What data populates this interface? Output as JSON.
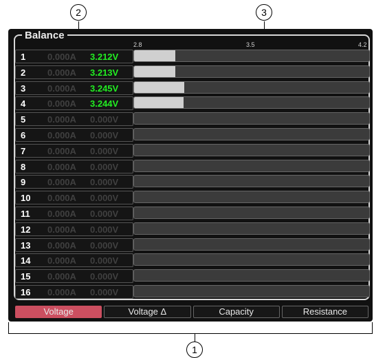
{
  "callouts": {
    "tabs": "1",
    "values": "2",
    "bars": "3"
  },
  "panel": {
    "title": "Balance"
  },
  "scale": {
    "min": "2.8",
    "mid": "3.5",
    "max": "4.2"
  },
  "cells": [
    {
      "num": "1",
      "amp": "0.000A",
      "volt": "3.212V",
      "active": true,
      "fill": 0.174
    },
    {
      "num": "2",
      "amp": "0.000A",
      "volt": "3.213V",
      "active": true,
      "fill": 0.175
    },
    {
      "num": "3",
      "amp": "0.000A",
      "volt": "3.245V",
      "active": true,
      "fill": 0.212
    },
    {
      "num": "4",
      "amp": "0.000A",
      "volt": "3.244V",
      "active": true,
      "fill": 0.211
    },
    {
      "num": "5",
      "amp": "0.000A",
      "volt": "0.000V",
      "active": false,
      "fill": 0
    },
    {
      "num": "6",
      "amp": "0.000A",
      "volt": "0.000V",
      "active": false,
      "fill": 0
    },
    {
      "num": "7",
      "amp": "0.000A",
      "volt": "0.000V",
      "active": false,
      "fill": 0
    },
    {
      "num": "8",
      "amp": "0.000A",
      "volt": "0.000V",
      "active": false,
      "fill": 0
    },
    {
      "num": "9",
      "amp": "0.000A",
      "volt": "0.000V",
      "active": false,
      "fill": 0
    },
    {
      "num": "10",
      "amp": "0.000A",
      "volt": "0.000V",
      "active": false,
      "fill": 0
    },
    {
      "num": "11",
      "amp": "0.000A",
      "volt": "0.000V",
      "active": false,
      "fill": 0
    },
    {
      "num": "12",
      "amp": "0.000A",
      "volt": "0.000V",
      "active": false,
      "fill": 0
    },
    {
      "num": "13",
      "amp": "0.000A",
      "volt": "0.000V",
      "active": false,
      "fill": 0
    },
    {
      "num": "14",
      "amp": "0.000A",
      "volt": "0.000V",
      "active": false,
      "fill": 0
    },
    {
      "num": "15",
      "amp": "0.000A",
      "volt": "0.000V",
      "active": false,
      "fill": 0
    },
    {
      "num": "16",
      "amp": "0.000A",
      "volt": "0.000V",
      "active": false,
      "fill": 0
    }
  ],
  "tabs": [
    {
      "label": "Voltage",
      "active": true
    },
    {
      "label": "Voltage Δ",
      "active": false
    },
    {
      "label": "Capacity",
      "active": false
    },
    {
      "label": "Resistance",
      "active": false
    }
  ]
}
